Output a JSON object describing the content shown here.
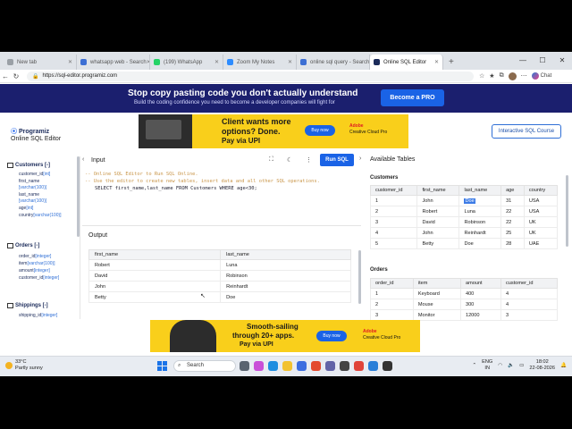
{
  "browser": {
    "tabs": [
      {
        "label": "New tab",
        "color": "#9aa0a6"
      },
      {
        "label": "whatsapp web - Search",
        "color": "#3c6fd4"
      },
      {
        "label": "(199) WhatsApp",
        "color": "#25d366"
      },
      {
        "label": "Zoom My Notes",
        "color": "#2d8cff"
      },
      {
        "label": "online sql query - Search",
        "color": "#3c6fd4"
      },
      {
        "label": "Online SQL Editor",
        "color": "#1b2b5a",
        "active": true
      }
    ],
    "url": "https://sql-editor.programiz.com",
    "chat_label": "Chat"
  },
  "banner": {
    "headline": "Stop copy pasting code you don't actually understand",
    "subline": "Build the coding confidence you need to become a developer companies will fight for",
    "cta": "Become a PRO"
  },
  "header": {
    "logo": "Programiz",
    "title": "Online SQL Editor",
    "interactive_button": "Interactive SQL Course"
  },
  "ad_top": {
    "line1": "Client wants more",
    "line2": "options? Done.",
    "line3": "Pay via UPI",
    "buy": "Buy now",
    "brand1": "Adobe",
    "brand2": "Creative Cloud Pro"
  },
  "schema": {
    "customers": {
      "title": "Customers [-]",
      "cols": [
        {
          "name": "customer_id",
          "type": "[int]"
        },
        {
          "name": "first_name",
          "type": ""
        },
        {
          "name": "",
          "type": "[varchar(100)]"
        },
        {
          "name": "last_name",
          "type": ""
        },
        {
          "name": "",
          "type": "[varchar(100)]"
        },
        {
          "name": "age",
          "type": "[int]"
        },
        {
          "name": "country",
          "type": "[varchar(100)]"
        }
      ]
    },
    "orders": {
      "title": "Orders [-]",
      "cols": [
        {
          "name": "order_id",
          "type": "[integer]"
        },
        {
          "name": "item",
          "type": "[varchar(100)]"
        },
        {
          "name": "amount",
          "type": "[integer]"
        },
        {
          "name": "customer_id",
          "type": "[integer]"
        }
      ]
    },
    "shippings": {
      "title": "Shippings [-]",
      "cols": [
        {
          "name": "shipping_id",
          "type": "[integer]"
        }
      ]
    }
  },
  "editor": {
    "input_label": "Input",
    "run_label": "Run SQL",
    "comment1": "-- Online SQL Editor to Run SQL Online.",
    "comment2": "-- Use the editor to create new tables, insert data and all other SQL operations.",
    "query": "SELECT first_name,last_name FROM Customers WHERE age<30;"
  },
  "output": {
    "label": "Output",
    "headers": [
      "first_name",
      "last_name"
    ],
    "rows": [
      [
        "Robert",
        "Luna"
      ],
      [
        "David",
        "Robinson"
      ],
      [
        "John",
        "Reinhardt"
      ],
      [
        "Betty",
        "Doe"
      ]
    ]
  },
  "available": {
    "label": "Available Tables",
    "customers": {
      "label": "Customers",
      "headers": [
        "customer_id",
        "first_name",
        "last_name",
        "age",
        "country"
      ],
      "rows": [
        [
          "1",
          "John",
          "Doe",
          "31",
          "USA"
        ],
        [
          "2",
          "Robert",
          "Luna",
          "22",
          "USA"
        ],
        [
          "3",
          "David",
          "Robinson",
          "22",
          "UK"
        ],
        [
          "4",
          "John",
          "Reinhardt",
          "25",
          "UK"
        ],
        [
          "5",
          "Betty",
          "Doe",
          "28",
          "UAE"
        ]
      ]
    },
    "orders": {
      "label": "Orders",
      "headers": [
        "order_id",
        "item",
        "amount",
        "customer_id"
      ],
      "rows": [
        [
          "1",
          "Keyboard",
          "400",
          "4"
        ],
        [
          "2",
          "Mouse",
          "300",
          "4"
        ],
        [
          "3",
          "Monitor",
          "12000",
          "3"
        ]
      ]
    }
  },
  "ad_bottom": {
    "line1": "Smooth-sailing",
    "line2": "through 20+ apps.",
    "line3": "Pay via UPI",
    "buy": "Buy now",
    "brand1": "Adobe",
    "brand2": "Creative Cloud Pro"
  },
  "taskbar": {
    "temp": "33°C",
    "weather": "Partly sunny",
    "search": "Search",
    "lang1": "ENG",
    "lang2": "IN",
    "time": "18:02",
    "date": "22-08-2026"
  }
}
